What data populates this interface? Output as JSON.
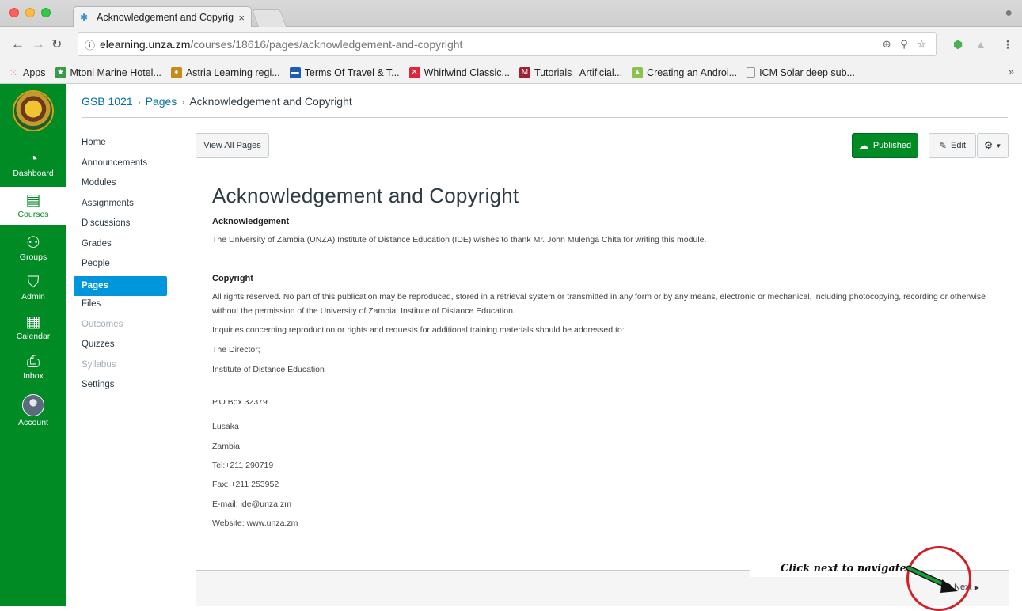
{
  "browser": {
    "tab_title": "Acknowledgement and Copyrig",
    "tab_close": "×",
    "url_host": "elearning.unza.zm",
    "url_path": "/courses/18616/pages/acknowledgement-and-copyright",
    "bookmarks": [
      "Apps",
      "Mtoni Marine Hotel...",
      "Astria Learning regi...",
      "Terms Of Travel & T...",
      "Whirlwind Classic...",
      "Tutorials | Artificial...",
      "Creating an Androi...",
      "ICM Solar deep sub..."
    ],
    "bookmarks_more": "»"
  },
  "global_nav": {
    "dashboard": "Dashboard",
    "courses": "Courses",
    "groups": "Groups",
    "admin": "Admin",
    "calendar": "Calendar",
    "inbox": "Inbox",
    "account": "Account"
  },
  "breadcrumb": {
    "course": "GSB 1021",
    "section": "Pages",
    "current": "Acknowledgement and Copyright"
  },
  "course_nav": {
    "items": [
      "Home",
      "Announcements",
      "Modules",
      "Assignments",
      "Discussions",
      "Grades",
      "People",
      "Pages",
      "Files",
      "Outcomes",
      "Quizzes",
      "Syllabus",
      "Settings"
    ]
  },
  "toolbar": {
    "view_all": "View All Pages",
    "published": "Published",
    "edit": "Edit"
  },
  "page": {
    "title": "Acknowledgement and Copyright",
    "ack_heading": "Acknowledgement",
    "ack_text": "The University of Zambia (UNZA) Institute of Distance Education (IDE) wishes to thank Mr. John Mulenga Chita for writing this module.",
    "copyright_heading": "Copyright",
    "copyright_text": "All rights reserved. No part of this publication may be reproduced, stored in a retrieval system or transmitted in any form or by any means, electronic or mechanical, including photocopying, recording or otherwise without the permission of the University of Zambia, Institute of Distance Education.",
    "inquiries": "Inquiries concerning reproduction or rights and requests for additional training materials should be addressed to:",
    "director": "The Director;",
    "institute": "Institute of Distance Education",
    "pobox": "P.O Box 32379",
    "city": "Lusaka",
    "country": "Zambia",
    "tel": "Tel:+211 290719",
    "fax": "Fax: +211 253952",
    "email": "E-mail: ide@unza.zm",
    "website": "Website: www.unza.zm"
  },
  "footer": {
    "next": "Next",
    "annotation": "Click next to navigate"
  },
  "colors": {
    "canvas_green": "#008b24",
    "active_blue": "#0096db",
    "link_blue": "#0770a3",
    "annotation_red": "#d31f26"
  }
}
